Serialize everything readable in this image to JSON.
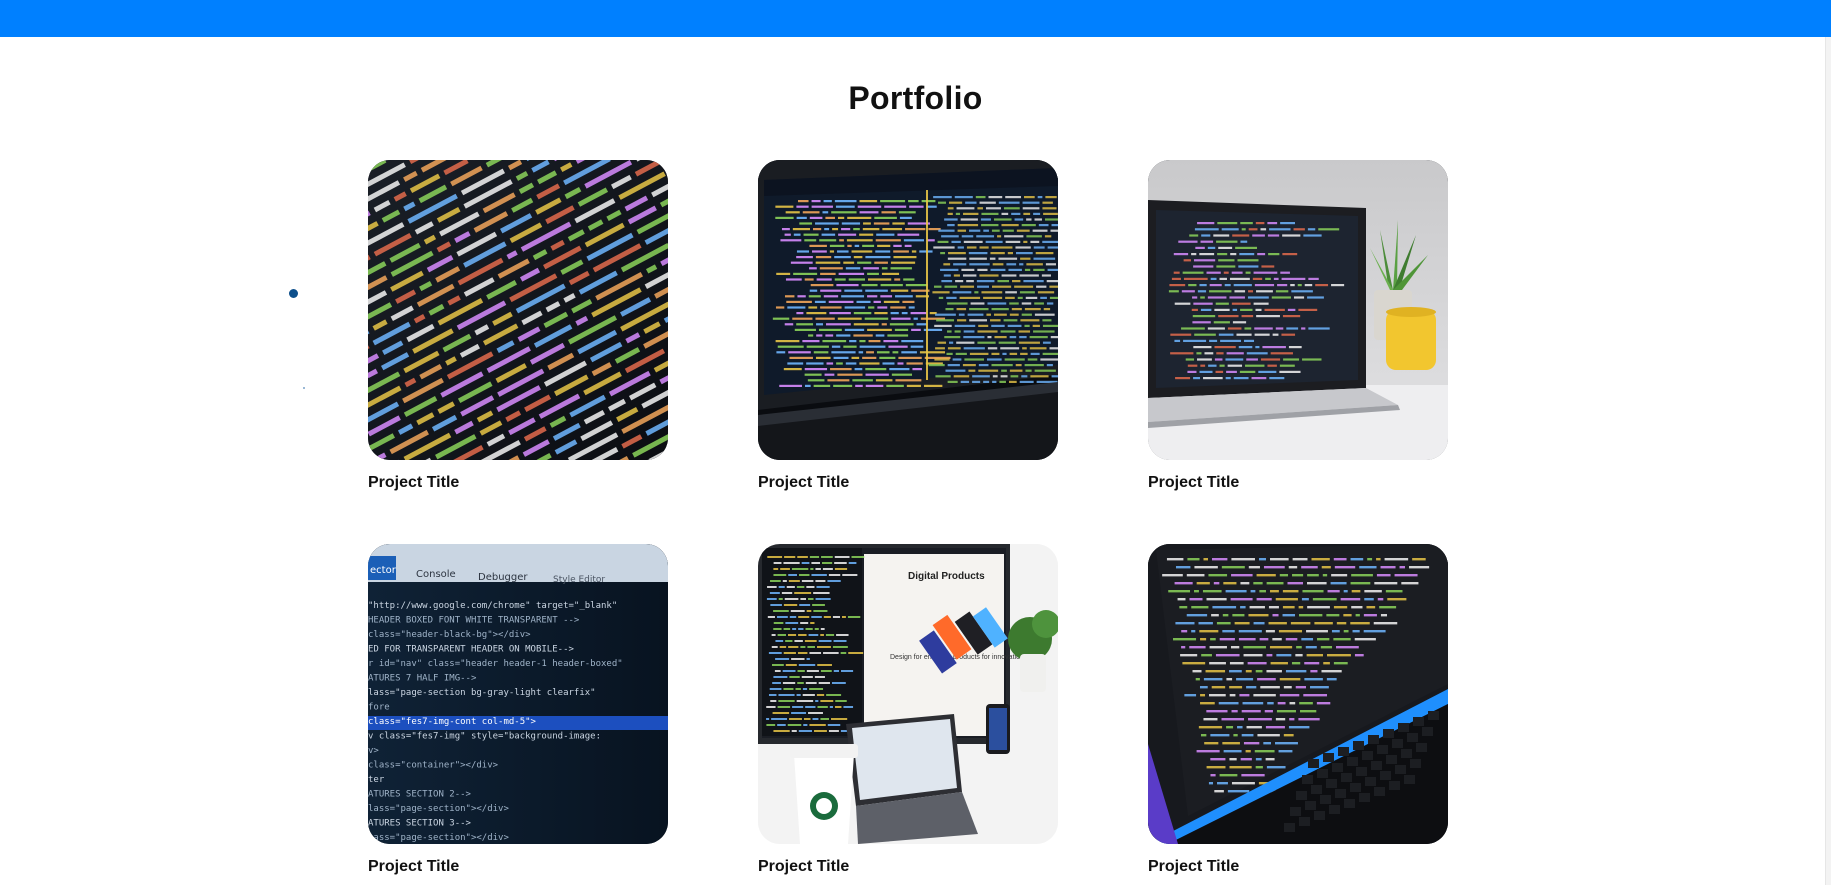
{
  "page": {
    "title": "Portfolio",
    "accent_color": "#0080ff"
  },
  "projects": [
    {
      "title": "Project Title",
      "image": "code-closeup-image"
    },
    {
      "title": "Project Title",
      "image": "laptop-code-dark-image"
    },
    {
      "title": "Project Title",
      "image": "laptop-desk-plant-image"
    },
    {
      "title": "Project Title",
      "image": "devtools-inspector-image"
    },
    {
      "title": "Project Title",
      "image": "desk-setup-image"
    },
    {
      "title": "Project Title",
      "image": "laptop-code-blue-image"
    }
  ],
  "screens": {
    "devtools_tabs": [
      "ector",
      "Console",
      "Debugger",
      "Style Editor"
    ],
    "devtools_lines": [
      "\"http://www.google.com/chrome\" target=\"_blank\"",
      "HEADER BOXED FONT WHITE TRANSPARENT -->",
      "class=\"header-black-bg\"></div>",
      "ED FOR TRANSPARENT HEADER ON MOBILE-->",
      "r id=\"nav\" class=\"header header-1 header-boxed\"",
      "ATURES 7 HALF IMG-->",
      "lass=\"page-section bg-gray-light clearfix\"",
      "fore",
      "class=\"fes7-img-cont col-md-5\">",
      "v class=\"fes7-img\" style=\"background-image:",
      "v>",
      "class=\"container\"></div>",
      "ter",
      "ATURES SECTION 2-->",
      "lass=\"page-section\"></div>",
      "ATURES SECTION 3-->",
      "lass=\"page-section\"></div>"
    ],
    "monitor_heading": "Digital Products",
    "monitor_tagline": "Design for enduring products for innovation"
  }
}
